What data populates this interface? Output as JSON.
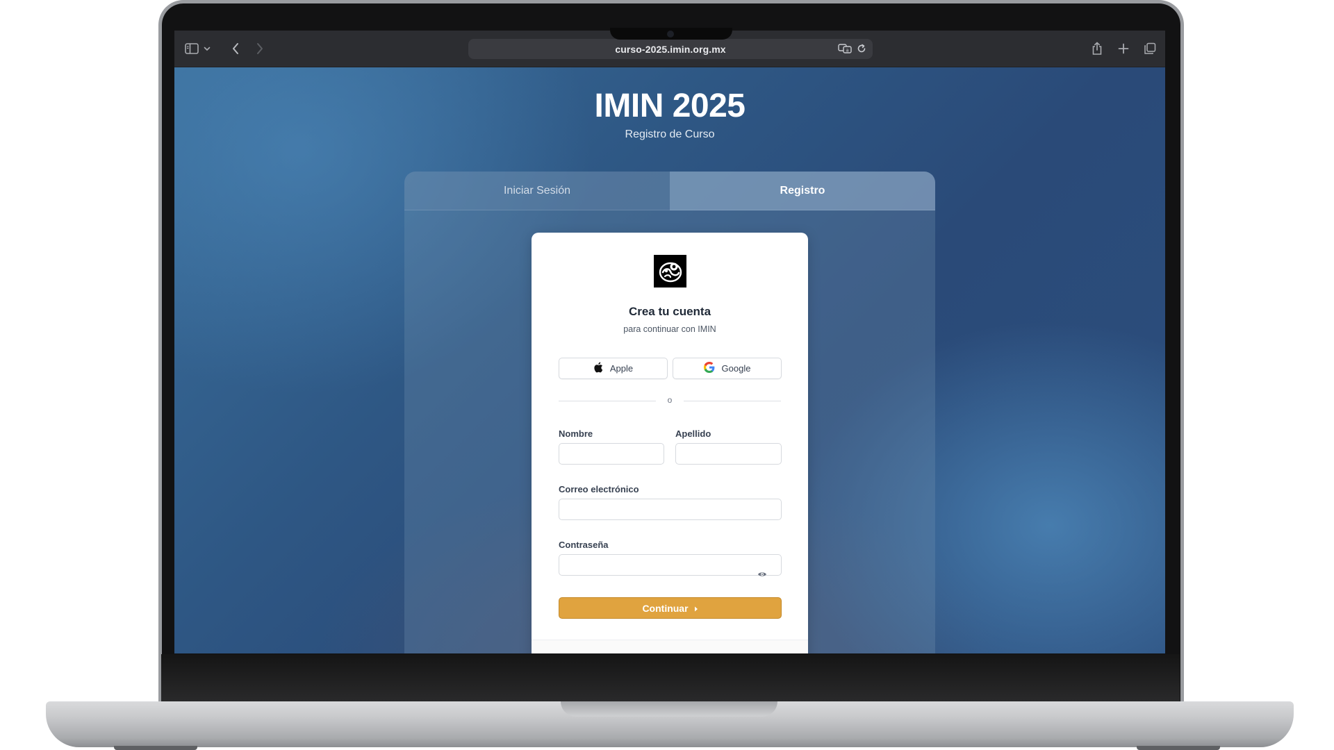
{
  "browser": {
    "url": "curso-2025.imin.org.mx",
    "icons": [
      "sidebar-icon",
      "chevron-down-icon",
      "back-icon",
      "forward-icon",
      "translate-icon",
      "reload-icon",
      "share-icon",
      "new-tab-icon",
      "tabs-overview-icon"
    ]
  },
  "page": {
    "title": "IMIN 2025",
    "subtitle": "Registro de Curso",
    "tabs": [
      {
        "label": "Iniciar Sesión",
        "active": false
      },
      {
        "label": "Registro",
        "active": true
      }
    ]
  },
  "card": {
    "title": "Crea tu cuenta",
    "subtitle": "para continuar con IMIN",
    "social": {
      "apple_label": "Apple",
      "google_label": "Google"
    },
    "divider": "o",
    "fields": {
      "first_name_label": "Nombre",
      "first_name_value": "",
      "last_name_label": "Apellido",
      "last_name_value": "",
      "email_label": "Correo electrónico",
      "email_value": "",
      "password_label": "Contraseña",
      "password_value": ""
    },
    "continue_label": "Continuar",
    "colors": {
      "accent": "#e0a33f",
      "active_tab": "#9fb8d2"
    }
  }
}
